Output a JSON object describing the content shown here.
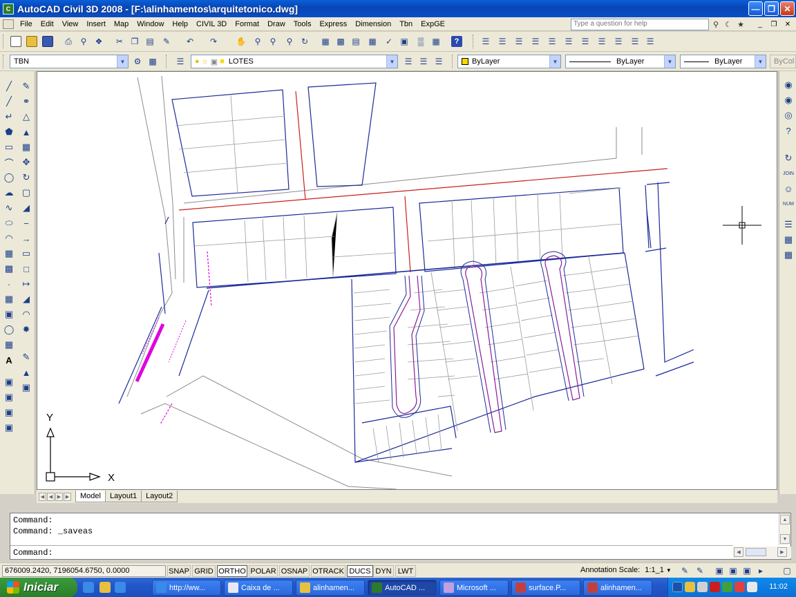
{
  "window": {
    "title": "AutoCAD Civil 3D 2008 - [F:\\alinhamentos\\arquitetonico.dwg]"
  },
  "menu": [
    "File",
    "Edit",
    "View",
    "Insert",
    "Map",
    "Window",
    "Help",
    "CIVIL 3D",
    "Format",
    "Draw",
    "Tools",
    "Express",
    "Dimension",
    "Tbn",
    "ExpGE"
  ],
  "help": {
    "placeholder": "Type a question for help"
  },
  "props": {
    "workspace": "TBN",
    "layer": "LOTES",
    "color": "ByLayer",
    "linetype": "ByLayer",
    "lineweight": "ByLayer",
    "plotstyle": "ByCol"
  },
  "tabs": [
    "Model",
    "Layout1",
    "Layout2"
  ],
  "ucs": {
    "x": "X",
    "y": "Y"
  },
  "command": {
    "lines": [
      "Command:",
      "Command: _saveas"
    ],
    "prompt": "Command:"
  },
  "status": {
    "coords": "676009.2420, 7196054.6750, 0.0000",
    "buttons": [
      {
        "label": "SNAP",
        "on": false
      },
      {
        "label": "GRID",
        "on": false
      },
      {
        "label": "ORTHO",
        "on": true
      },
      {
        "label": "POLAR",
        "on": false
      },
      {
        "label": "OSNAP",
        "on": false
      },
      {
        "label": "OTRACK",
        "on": false
      },
      {
        "label": "DUCS",
        "on": true
      },
      {
        "label": "DYN",
        "on": false
      },
      {
        "label": "LWT",
        "on": false
      }
    ],
    "annotation_label": "Annotation Scale:",
    "annotation_value": "1:1_1"
  },
  "taskbar": {
    "start": "Iniciar",
    "items": [
      "http://ww...",
      "Caixa de ...",
      "alinhamen...",
      "AutoCAD ...",
      "Microsoft ...",
      "surface.P...",
      "alinhamen..."
    ],
    "clock": "11:02"
  },
  "colors": {
    "lot_lines": "#1a2a9a",
    "road_centerline": "#c81e1e",
    "alignment": "#8a1a9a",
    "highlight": "#e000e0"
  }
}
